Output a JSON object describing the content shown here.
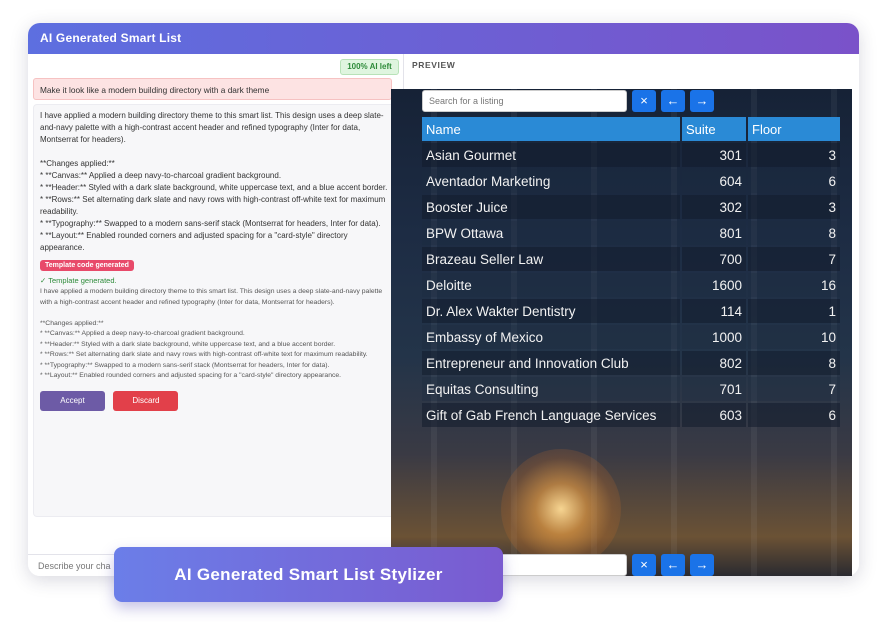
{
  "window": {
    "title": "AI Generated Smart List"
  },
  "ai_badge": "100% AI left",
  "chat": {
    "user_message": "Make it look like a modern building directory with a dark theme",
    "assistant_message": "I have applied a modern building directory theme to this smart list. This design uses a deep slate-and-navy palette with a high-contrast accent header and refined typography (Inter for data, Montserrat for headers).\n\n**Changes applied:**\n* **Canvas:** Applied a deep navy-to-charcoal gradient background.\n* **Header:** Styled with a dark slate background, white uppercase text, and a blue accent border.\n* **Rows:** Set alternating dark slate and navy rows with high-contrast off-white text for maximum readability.\n* **Typography:** Swapped to a modern sans-serif stack (Montserrat for headers, Inter for data).\n* **Layout:** Enabled rounded corners and adjusted spacing for a \"card-style\" directory appearance.",
    "template_chip": "Template code generated",
    "template_generated": "✓  Template generated.",
    "generated_summary": "I have applied a modern building directory theme to this smart list. This design uses a deep slate-and-navy palette with a high-contrast accent header and refined typography (Inter for data, Montserrat for headers).\n\n**Changes applied:**\n* **Canvas:** Applied a deep navy-to-charcoal gradient background.\n* **Header:** Styled with a dark slate background, white uppercase text, and a blue accent border.\n* **Rows:** Set alternating dark slate and navy rows with high-contrast off-white text for maximum readability.\n* **Typography:** Swapped to a modern sans-serif stack (Montserrat for headers, Inter for data).\n* **Layout:** Enabled rounded corners and adjusted spacing for a \"card-style\" directory appearance.",
    "accept_label": "Accept",
    "discard_label": "Discard",
    "input_placeholder": "Describe your cha"
  },
  "preview": {
    "label": "PREVIEW",
    "search_placeholder": "Search for a listing",
    "icons": {
      "clear": "×",
      "prev": "←",
      "next": "→"
    },
    "columns": [
      "Name",
      "Suite",
      "Floor"
    ],
    "rows": [
      {
        "name": "Asian Gourmet",
        "suite": "301",
        "floor": "3"
      },
      {
        "name": "Aventador Marketing",
        "suite": "604",
        "floor": "6"
      },
      {
        "name": "Booster Juice",
        "suite": "302",
        "floor": "3"
      },
      {
        "name": "BPW Ottawa",
        "suite": "801",
        "floor": "8"
      },
      {
        "name": "Brazeau Seller Law",
        "suite": "700",
        "floor": "7"
      },
      {
        "name": "Deloitte",
        "suite": "1600",
        "floor": "16"
      },
      {
        "name": "Dr. Alex Wakter Dentistry",
        "suite": "114",
        "floor": "1"
      },
      {
        "name": "Embassy of Mexico",
        "suite": "1000",
        "floor": "10"
      },
      {
        "name": "Entrepreneur and Innovation Club",
        "suite": "802",
        "floor": "8"
      },
      {
        "name": "Equitas Consulting",
        "suite": "701",
        "floor": "7"
      },
      {
        "name": "Gift of Gab French Language Services",
        "suite": "603",
        "floor": "6"
      }
    ]
  },
  "banner": {
    "text": "AI Generated Smart List Stylizer"
  },
  "colors": {
    "accent": "#1a73e8",
    "header": "#2a8ad6",
    "title_gradient_start": "#5d6fe0",
    "title_gradient_end": "#7a52c9"
  }
}
